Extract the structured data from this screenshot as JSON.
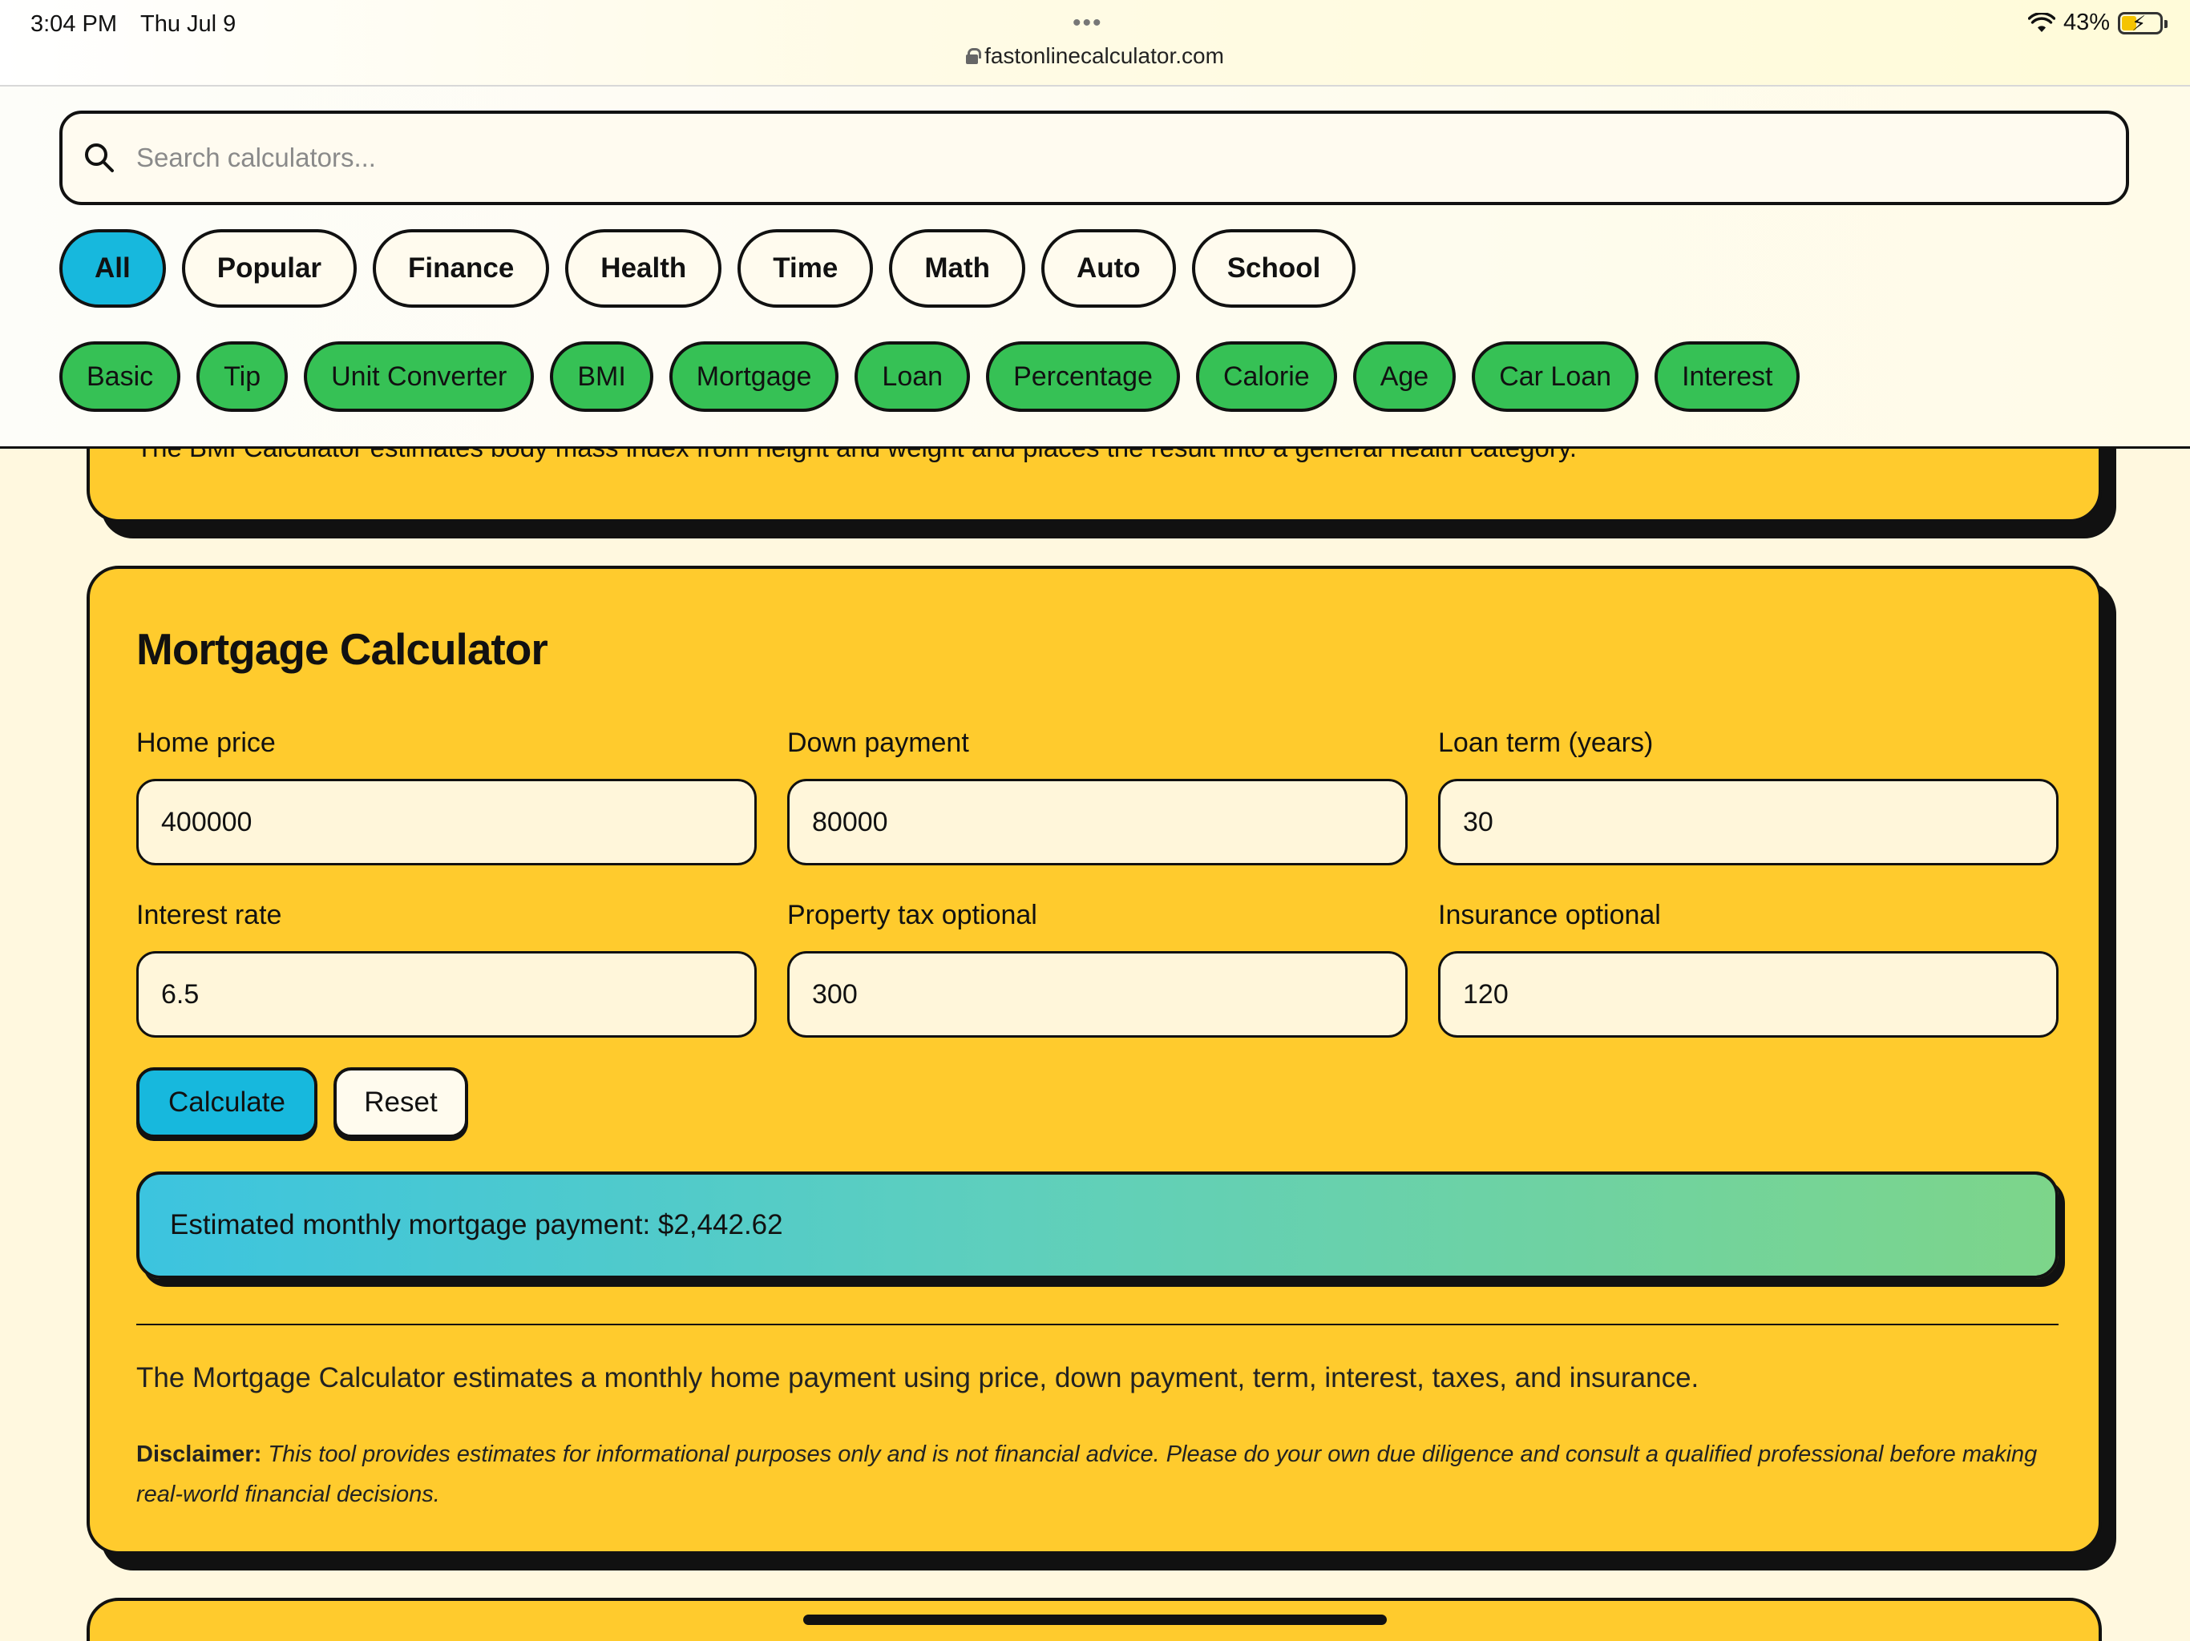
{
  "status_bar": {
    "time": "3:04 PM",
    "date": "Thu Jul 9",
    "dots": "•••",
    "url": "fastonlinecalculator.com",
    "battery": "43%"
  },
  "search": {
    "placeholder": "Search calculators..."
  },
  "categories": [
    "All",
    "Popular",
    "Finance",
    "Health",
    "Time",
    "Math",
    "Auto",
    "School"
  ],
  "active_category": "All",
  "quick_links": [
    "Basic",
    "Tip",
    "Unit Converter",
    "BMI",
    "Mortgage",
    "Loan",
    "Percentage",
    "Calorie",
    "Age",
    "Car Loan",
    "Interest"
  ],
  "previous_card": {
    "text": "The BMI Calculator estimates body mass index from height and weight and places the result into a general health category."
  },
  "mortgage": {
    "title": "Mortgage Calculator",
    "fields": [
      {
        "label": "Home price",
        "value": "400000"
      },
      {
        "label": "Down payment",
        "value": "80000"
      },
      {
        "label": "Loan term (years)",
        "value": "30"
      },
      {
        "label": "Interest rate",
        "value": "6.5"
      },
      {
        "label": "Property tax optional",
        "value": "300"
      },
      {
        "label": "Insurance optional",
        "value": "120"
      }
    ],
    "calculate_label": "Calculate",
    "reset_label": "Reset",
    "result": "Estimated monthly mortgage payment: $2,442.62",
    "description": "The Mortgage Calculator estimates a monthly home payment using price, down payment, term, interest, taxes, and insurance.",
    "disclaimer_label": "Disclaimer:",
    "disclaimer_text": "This tool provides estimates for informational purposes only and is not financial advice. Please do your own due diligence and consult a qualified professional before making real-world financial decisions."
  },
  "colors": {
    "card": "#ffcb2d",
    "accent_blue": "#17b8dd",
    "chip_green": "#36c155",
    "background": "#fff8df"
  }
}
